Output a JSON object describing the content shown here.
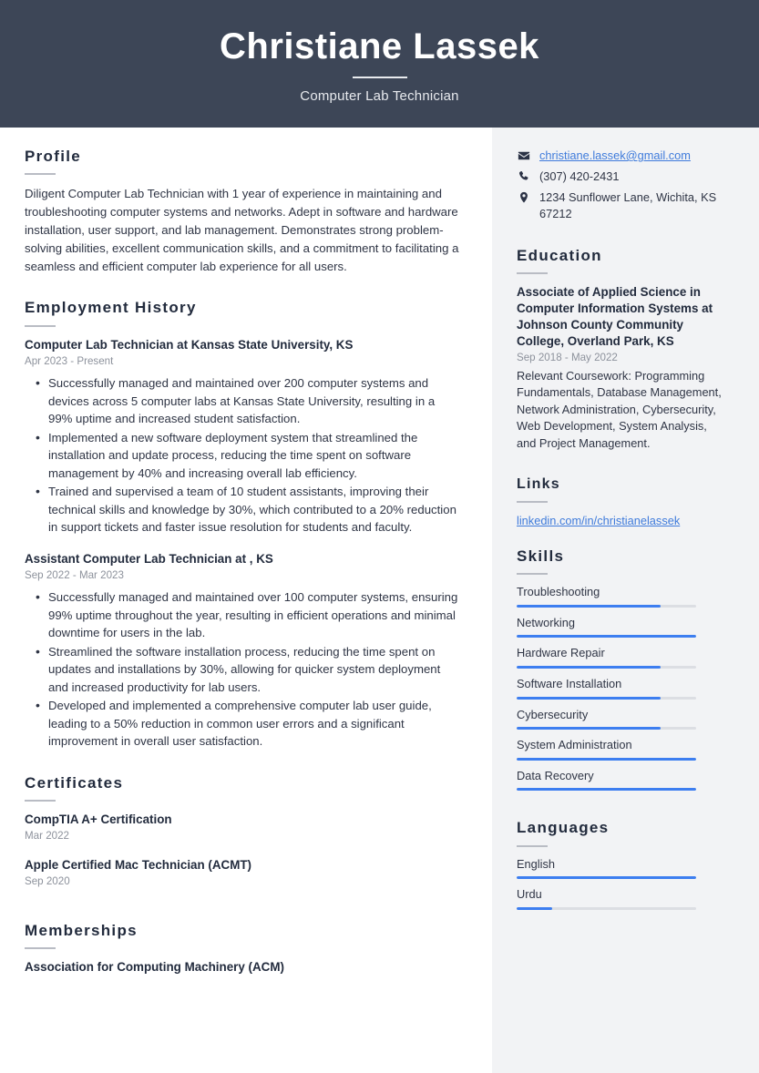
{
  "header": {
    "name": "Christiane Lassek",
    "job_title": "Computer Lab Technician",
    "background_color": "#3d4657"
  },
  "theme": {
    "accent_color": "#3d7ef0",
    "link_color": "#3f7bdb",
    "heading_color": "#222b3d",
    "muted_color": "#8d929c",
    "sidebar_background": "#f2f3f5"
  },
  "main": {
    "profile": {
      "heading": "Profile",
      "text": "Diligent Computer Lab Technician with 1 year of experience in maintaining and troubleshooting computer systems and networks. Adept in software and hardware installation, user support, and lab management. Demonstrates strong problem-solving abilities, excellent communication skills, and a commitment to facilitating a seamless and efficient computer lab experience for all users."
    },
    "employment": {
      "heading": "Employment History",
      "jobs": [
        {
          "title": "Computer Lab Technician at Kansas State University, KS",
          "date": "Apr 2023 - Present",
          "bullets": [
            "Successfully managed and maintained over 200 computer systems and devices across 5 computer labs at Kansas State University, resulting in a 99% uptime and increased student satisfaction.",
            "Implemented a new software deployment system that streamlined the installation and update process, reducing the time spent on software management by 40% and increasing overall lab efficiency.",
            "Trained and supervised a team of 10 student assistants, improving their technical skills and knowledge by 30%, which contributed to a 20% reduction in support tickets and faster issue resolution for students and faculty."
          ]
        },
        {
          "title": "Assistant Computer Lab Technician at , KS",
          "date": "Sep 2022 - Mar 2023",
          "bullets": [
            "Successfully managed and maintained over 100 computer systems, ensuring 99% uptime throughout the year, resulting in efficient operations and minimal downtime for users in the lab.",
            "Streamlined the software installation process, reducing the time spent on updates and installations by 30%, allowing for quicker system deployment and increased productivity for lab users.",
            "Developed and implemented a comprehensive computer lab user guide, leading to a 50% reduction in common user errors and a significant improvement in overall user satisfaction."
          ]
        }
      ]
    },
    "certificates": {
      "heading": "Certificates",
      "items": [
        {
          "name": "CompTIA A+ Certification",
          "date": "Mar 2022"
        },
        {
          "name": "Apple Certified Mac Technician (ACMT)",
          "date": "Sep 2020"
        }
      ]
    },
    "memberships": {
      "heading": "Memberships",
      "items": [
        {
          "name": "Association for Computing Machinery (ACM)"
        }
      ]
    }
  },
  "sidebar": {
    "contact": [
      {
        "icon": "envelope-icon",
        "text": "christiane.lassek@gmail.com",
        "is_link": true
      },
      {
        "icon": "phone-icon",
        "text": "(307) 420-2431",
        "is_link": false
      },
      {
        "icon": "location-pin-icon",
        "text": "1234 Sunflower Lane, Wichita, KS 67212",
        "is_link": false
      }
    ],
    "education": {
      "heading": "Education",
      "title": "Associate of Applied Science in Computer Information Systems at Johnson County Community College, Overland Park, KS",
      "date": "Sep 2018 - May 2022",
      "description": "Relevant Coursework: Programming Fundamentals, Database Management, Network Administration, Cybersecurity, Web Development, System Analysis, and Project Management."
    },
    "links": {
      "heading": "Links",
      "items": [
        {
          "label": "linkedin.com/in/christianelassek"
        }
      ]
    },
    "skills": {
      "heading": "Skills",
      "items": [
        {
          "label": "Troubleshooting",
          "level": 80
        },
        {
          "label": "Networking",
          "level": 100
        },
        {
          "label": "Hardware Repair",
          "level": 80
        },
        {
          "label": "Software Installation",
          "level": 80
        },
        {
          "label": "Cybersecurity",
          "level": 80
        },
        {
          "label": "System Administration",
          "level": 100
        },
        {
          "label": "Data Recovery",
          "level": 100
        }
      ]
    },
    "languages": {
      "heading": "Languages",
      "items": [
        {
          "label": "English",
          "level": 100
        },
        {
          "label": "Urdu",
          "level": 20
        }
      ]
    }
  }
}
